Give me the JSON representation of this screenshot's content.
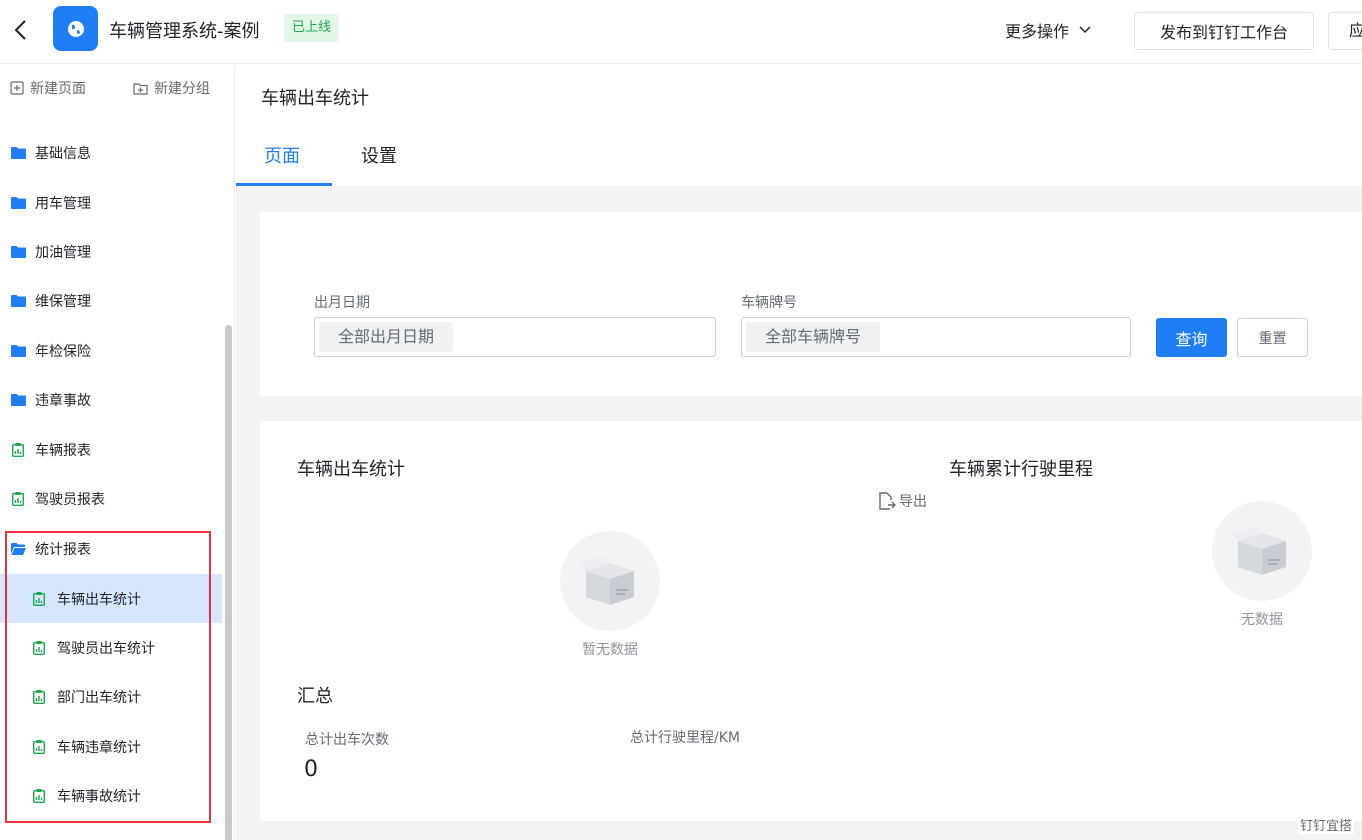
{
  "topbar": {
    "app_title": "车辆管理系统-案例",
    "status_badge": "已上线",
    "more_ops": "更多操作",
    "publish": "发布到钉钉工作台",
    "app_btn": "应"
  },
  "sidebar": {
    "new_page": "新建页面",
    "new_group": "新建分组",
    "items": [
      {
        "label": "基础信息",
        "icon": "folder-icon"
      },
      {
        "label": "用车管理",
        "icon": "folder-icon"
      },
      {
        "label": "加油管理",
        "icon": "folder-icon"
      },
      {
        "label": "维保管理",
        "icon": "folder-icon"
      },
      {
        "label": "年检保险",
        "icon": "folder-icon"
      },
      {
        "label": "违章事故",
        "icon": "folder-icon"
      },
      {
        "label": "车辆报表",
        "icon": "report-icon"
      },
      {
        "label": "驾驶员报表",
        "icon": "report-icon"
      },
      {
        "label": "统计报表",
        "icon": "folder-open-icon"
      }
    ],
    "children": [
      {
        "label": "车辆出车统计",
        "icon": "report-icon",
        "active": true
      },
      {
        "label": "驾驶员出车统计",
        "icon": "report-icon"
      },
      {
        "label": "部门出车统计",
        "icon": "report-icon"
      },
      {
        "label": "车辆违章统计",
        "icon": "report-icon"
      },
      {
        "label": "车辆事故统计",
        "icon": "report-icon"
      }
    ]
  },
  "main": {
    "page_title": "车辆出车统计",
    "tabs": [
      {
        "label": "页面"
      },
      {
        "label": "设置"
      }
    ],
    "filters": {
      "date_label": "出月日期",
      "date_value": "全部出月日期",
      "plate_label": "车辆牌号",
      "plate_value": "全部车辆牌号",
      "query": "查询",
      "reset": "重置"
    },
    "report": {
      "left_title": "车辆出车统计",
      "right_title": "车辆累计行驶里程",
      "export": "导出",
      "left_empty": "暂无数据",
      "right_empty": "无数据",
      "summary_title": "汇总",
      "total_trips_label": "总计出车次数",
      "total_trips_value": "0",
      "total_km_label": "总计行驶里程/KM"
    }
  },
  "watermark": "钉钉宜搭",
  "colors": {
    "accent": "#1f7ef5",
    "success": "#1aa84f",
    "highlight": "#e8333b"
  }
}
